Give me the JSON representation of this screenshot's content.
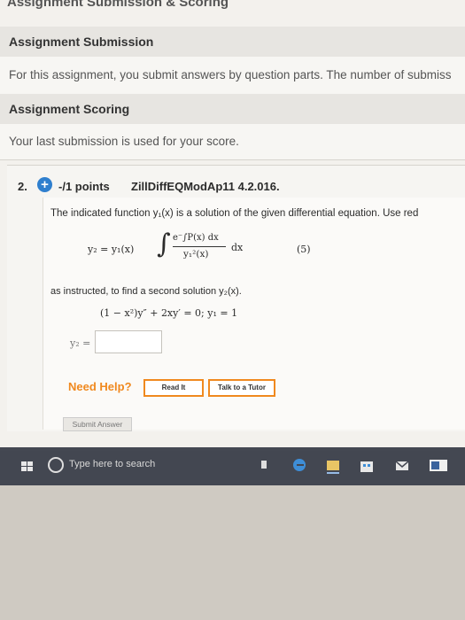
{
  "header": {
    "title": "Assignment Submission & Scoring"
  },
  "sections": [
    {
      "heading": "Assignment Submission"
    },
    {
      "text": "For this assignment, you submit answers by question parts. The number of submiss"
    },
    {
      "heading": "Assignment Scoring"
    },
    {
      "text": "Your last submission is used for your score."
    }
  ],
  "question": {
    "number": "2.",
    "points": "-/1 points",
    "code": "ZillDiffEQModAp11 4.2.016.",
    "prompt": "The indicated function y₁(x) is a solution of the given differential equation. Use red",
    "formula_left": "y₂ = y₁(x)",
    "formula_integral": "∫",
    "formula_numerator": "e⁻∫P(x) dx",
    "formula_denominator": "y₁²(x)",
    "formula_dx": "dx",
    "formula_number": "(5)",
    "instruction": "as instructed, to find a second solution y₂(x).",
    "ode": "(1 − x²)y″ + 2xy′ = 0;    y₁ = 1",
    "answer_label": "y₂ =",
    "answer_value": "",
    "need_help": "Need Help?",
    "read_it": "Read It",
    "talk_to_tutor": "Talk to a Tutor",
    "submit": "Submit Answer"
  },
  "taskbar": {
    "search_placeholder": "Type here to search",
    "icons": [
      "windows-start-icon",
      "cortana-circle-icon",
      "download-icon",
      "edge-browser-icon",
      "file-explorer-icon",
      "store-icon",
      "mail-icon",
      "word-icon"
    ]
  },
  "colors": {
    "accent": "#2f7fce",
    "help_orange": "#f0891f",
    "taskbar": "#353944"
  }
}
